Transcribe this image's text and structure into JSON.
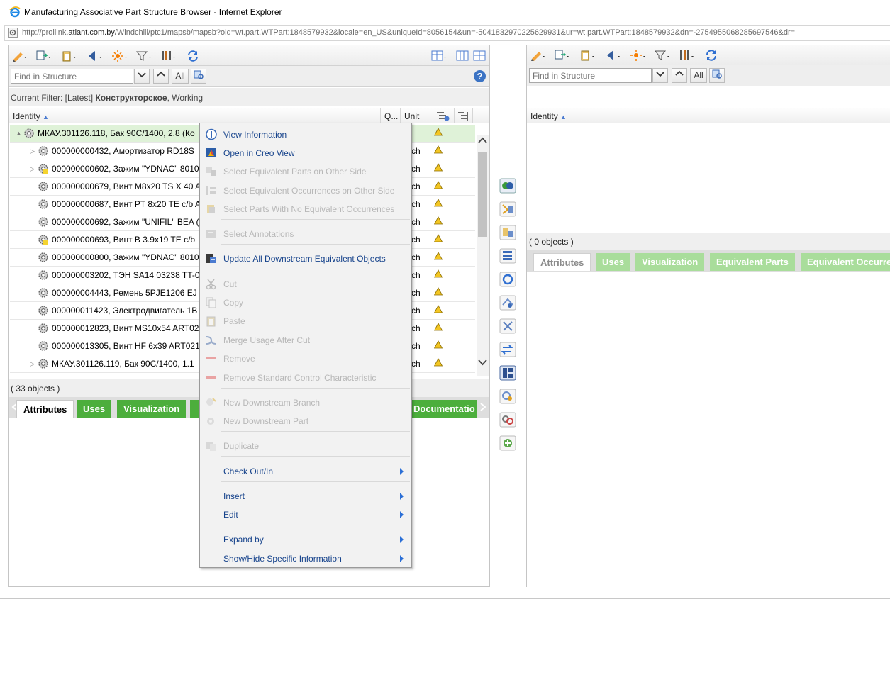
{
  "window": {
    "title": "Manufacturing Associative Part Structure Browser - Internet Explorer",
    "url_prefix": "http://proilink.",
    "url_host": "atlant.com.by",
    "url_rest": "/Windchill/ptc1/mapsb/mapsb?oid=wt.part.WTPart:1848579932&locale=en_US&uniqueId=8056154&un=-5041832970225629931&ur=wt.part.WTPart:1848579932&dn=-2754955068285697546&dr="
  },
  "left": {
    "find_placeholder": "Find in Structure",
    "find_all": "All",
    "filter_label": "Current Filter: [Latest] ",
    "filter_bold": "Конструкторское",
    "filter_rest": ", Working",
    "columns": {
      "identity": "Identity",
      "qty": "Q...",
      "unit": "Unit"
    },
    "rows": [
      {
        "text": "МКАУ.301126.118, Бак 90С/1400, 2.8 (Ко",
        "unit": "",
        "expander": "▲",
        "selected": true
      },
      {
        "text": "000000000432, Амортизатор RD18S",
        "unit": "ch",
        "expander": "▷"
      },
      {
        "text": "000000000602, Зажим \"YDNAC\" 8010",
        "unit": "ch",
        "expander": "▷"
      },
      {
        "text": "000000000679, Винт M8x20 TS X 40 A",
        "unit": "ch",
        "expander": ""
      },
      {
        "text": "000000000687, Винт PT 8x20 TE c/b A",
        "unit": "ch",
        "expander": ""
      },
      {
        "text": "000000000692, Зажим \"UNIFIL\" BEA (",
        "unit": "ch",
        "expander": ""
      },
      {
        "text": "000000000693, Винт В 3.9x19 TE c/b",
        "unit": "ch",
        "expander": ""
      },
      {
        "text": "000000000800, Зажим \"YDNAC\" 8010",
        "unit": "ch",
        "expander": ""
      },
      {
        "text": "000000003202, ТЭН SA14 03238 TT-0",
        "unit": "ch",
        "expander": ""
      },
      {
        "text": "000000004443, Ремень 5PJE1206 EJ",
        "unit": "ch",
        "expander": ""
      },
      {
        "text": "000000011423, Электродвигатель 1В",
        "unit": "ch",
        "expander": ""
      },
      {
        "text": "000000012823, Винт MS10x54 ART02",
        "unit": "ch",
        "expander": ""
      },
      {
        "text": "000000013305, Винт HF 6x39 ART021",
        "unit": "ch",
        "expander": ""
      },
      {
        "text": "МКАУ.301126.119, Бак 90С/1400, 1.1",
        "unit": "ch",
        "expander": "▷"
      }
    ],
    "count": "( 33 objects )",
    "tabs": {
      "attributes": "Attributes",
      "uses": "Uses",
      "visualization": "Visualization",
      "documentation": "Documentatio"
    }
  },
  "right": {
    "find_placeholder": "Find in Structure",
    "find_all": "All",
    "columns": {
      "identity": "Identity"
    },
    "count": "( 0 objects )",
    "tabs": {
      "attributes": "Attributes",
      "uses": "Uses",
      "visualization": "Visualization",
      "equivalent_parts": "Equivalent Parts",
      "equivalent_occurrences": "Equivalent Occurre"
    }
  },
  "menu": {
    "view_information": "View Information",
    "open_in_creo": "Open in Creo View",
    "select_equiv_parts": "Select Equivalent Parts on Other Side",
    "select_equiv_occ": "Select Equivalent Occurrences on Other Side",
    "select_no_equiv": "Select Parts With No Equivalent Occurrences",
    "select_annotations": "Select Annotations",
    "update_downstream": "Update All Downstream Equivalent Objects",
    "cut": "Cut",
    "copy": "Copy",
    "paste": "Paste",
    "merge_usage": "Merge Usage After Cut",
    "remove": "Remove",
    "remove_standard": "Remove Standard Control Characteristic",
    "new_downstream_branch": "New Downstream Branch",
    "new_downstream_part": "New Downstream Part",
    "duplicate": "Duplicate",
    "check_out_in": "Check Out/In",
    "insert": "Insert",
    "edit": "Edit",
    "expand_by": "Expand by",
    "show_hide": "Show/Hide Specific Information"
  },
  "colors": {
    "accent_green": "#4cae3c",
    "menu_text": "#15428b",
    "selected_row": "#dff2d8"
  }
}
